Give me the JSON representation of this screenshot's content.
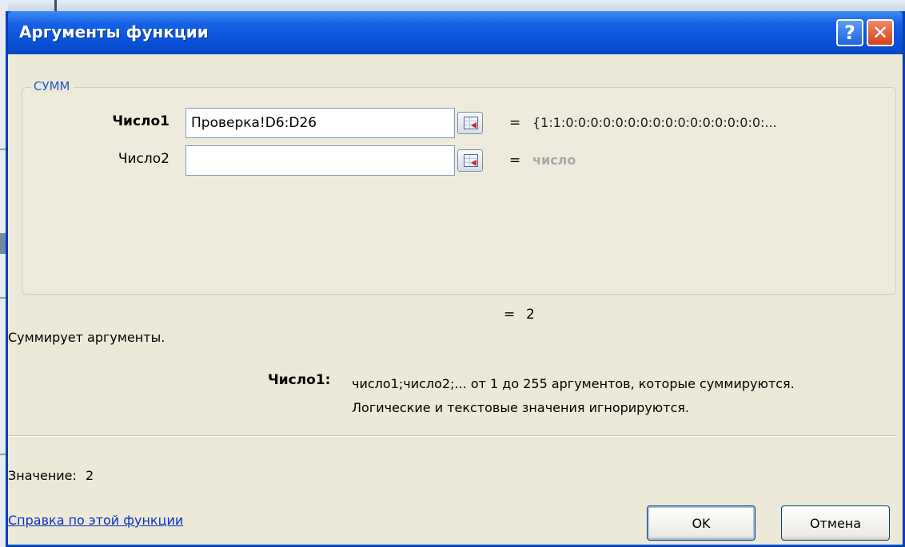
{
  "window": {
    "title": "Аргументы функции",
    "help_label": "?",
    "close_label": "✕"
  },
  "function": {
    "name": "СУММ",
    "args": [
      {
        "label": "Число1",
        "value": "Проверка!D6:D26",
        "result": "{1:1:0:0:0:0:0:0:0:0:0:0:0:0:0:0:0:0:..."
      },
      {
        "label": "Число2",
        "value": "",
        "result": "число"
      }
    ],
    "equals": "=",
    "overall_result": "2",
    "description": "Суммирует аргументы.",
    "arg_help": {
      "name": "Число1:",
      "text_line1": "число1;число2;... от 1 до 255 аргументов, которые суммируются.",
      "text_line2": "Логические и текстовые значения игнорируются."
    }
  },
  "footer": {
    "value_label": "Значение:",
    "value": "2",
    "help_link": "Справка по этой функции",
    "ok_label": "OK",
    "cancel_label": "Отмена"
  },
  "icons": {
    "ref": "collapse-dialog-icon"
  }
}
